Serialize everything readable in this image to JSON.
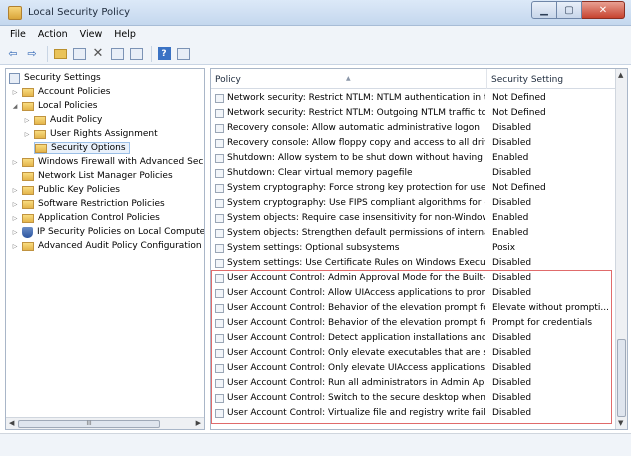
{
  "window": {
    "title": "Local Security Policy"
  },
  "menu": [
    "File",
    "Action",
    "View",
    "Help"
  ],
  "toolbar": {
    "icons": [
      "back-arrow-icon",
      "forward-arrow-icon",
      "up-folder-icon",
      "show-hide-tree-icon",
      "delete-icon",
      "properties-icon",
      "export-list-icon",
      "help-icon",
      "show-hide-action-pane-icon"
    ]
  },
  "tree": {
    "items": [
      {
        "label": "Security Settings",
        "level": 0,
        "arrow": "",
        "icon": "root"
      },
      {
        "label": "Account Policies",
        "level": 1,
        "arrow": "▷",
        "icon": "folder"
      },
      {
        "label": "Local Policies",
        "level": 1,
        "arrow": "◢",
        "icon": "folder"
      },
      {
        "label": "Audit Policy",
        "level": 2,
        "arrow": "▷",
        "icon": "folder"
      },
      {
        "label": "User Rights Assignment",
        "level": 2,
        "arrow": "▷",
        "icon": "folder"
      },
      {
        "label": "Security Options",
        "level": 2,
        "arrow": "",
        "icon": "folder",
        "selected": true
      },
      {
        "label": "Windows Firewall with Advanced Secu",
        "level": 0,
        "arrow": "▷",
        "icon": "folder"
      },
      {
        "label": "Network List Manager Policies",
        "level": 0,
        "arrow": "",
        "icon": "folder"
      },
      {
        "label": "Public Key Policies",
        "level": 0,
        "arrow": "▷",
        "icon": "folder"
      },
      {
        "label": "Software Restriction Policies",
        "level": 0,
        "arrow": "▷",
        "icon": "folder"
      },
      {
        "label": "Application Control Policies",
        "level": 0,
        "arrow": "▷",
        "icon": "folder"
      },
      {
        "label": "IP Security Policies on Local Compute",
        "level": 0,
        "arrow": "▷",
        "icon": "shield"
      },
      {
        "label": "Advanced Audit Policy Configuration",
        "level": 0,
        "arrow": "▷",
        "icon": "folder"
      }
    ],
    "scroll_thumb_label": "III"
  },
  "list": {
    "columns": {
      "policy": "Policy",
      "setting": "Security Setting"
    },
    "rows": [
      {
        "policy": "Network security: Restrict NTLM: NTLM authentication in th...",
        "setting": "Not Defined"
      },
      {
        "policy": "Network security: Restrict NTLM: Outgoing NTLM traffic to ...",
        "setting": "Not Defined"
      },
      {
        "policy": "Recovery console: Allow automatic administrative logon",
        "setting": "Disabled"
      },
      {
        "policy": "Recovery console: Allow floppy copy and access to all drives...",
        "setting": "Disabled"
      },
      {
        "policy": "Shutdown: Allow system to be shut down without having to...",
        "setting": "Enabled"
      },
      {
        "policy": "Shutdown: Clear virtual memory pagefile",
        "setting": "Disabled"
      },
      {
        "policy": "System cryptography: Force strong key protection for user k...",
        "setting": "Not Defined"
      },
      {
        "policy": "System cryptography: Use FIPS compliant algorithms for en...",
        "setting": "Disabled"
      },
      {
        "policy": "System objects: Require case insensitivity for non-Windows ...",
        "setting": "Enabled"
      },
      {
        "policy": "System objects: Strengthen default permissions of internal s...",
        "setting": "Enabled"
      },
      {
        "policy": "System settings: Optional subsystems",
        "setting": "Posix"
      },
      {
        "policy": "System settings: Use Certificate Rules on Windows Executabl...",
        "setting": "Disabled"
      },
      {
        "policy": "User Account Control: Admin Approval Mode for the Built-i...",
        "setting": "Disabled"
      },
      {
        "policy": "User Account Control: Allow UIAccess applications to prom...",
        "setting": "Disabled"
      },
      {
        "policy": "User Account Control: Behavior of the elevation prompt for ...",
        "setting": "Elevate without prompti..."
      },
      {
        "policy": "User Account Control: Behavior of the elevation prompt for ...",
        "setting": "Prompt for credentials"
      },
      {
        "policy": "User Account Control: Detect application installations and p...",
        "setting": "Disabled"
      },
      {
        "policy": "User Account Control: Only elevate executables that are sign...",
        "setting": "Disabled"
      },
      {
        "policy": "User Account Control: Only elevate UIAccess applications th...",
        "setting": "Disabled"
      },
      {
        "policy": "User Account Control: Run all administrators in Admin Appr...",
        "setting": "Disabled"
      },
      {
        "policy": "User Account Control: Switch to the secure desktop when pr...",
        "setting": "Disabled"
      },
      {
        "policy": "User Account Control: Virtualize file and registry write failure...",
        "setting": "Disabled"
      }
    ]
  },
  "colors": {
    "highlight_border": "#e06b6b",
    "selection_bg": "#e9f1fb",
    "close_button": "#c7432f"
  }
}
